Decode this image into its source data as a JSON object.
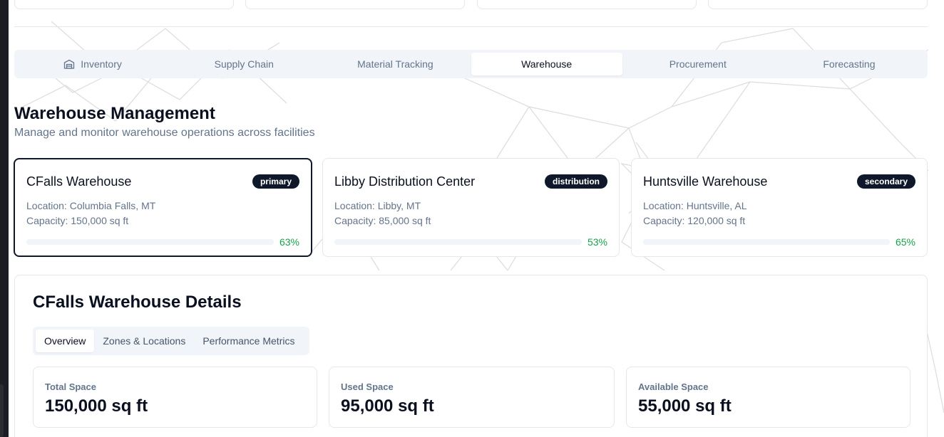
{
  "tabs": [
    {
      "label": "Inventory",
      "icon": "warehouse-icon"
    },
    {
      "label": "Supply Chain"
    },
    {
      "label": "Material Tracking"
    },
    {
      "label": "Warehouse",
      "active": true
    },
    {
      "label": "Procurement"
    },
    {
      "label": "Forecasting"
    }
  ],
  "header": {
    "title": "Warehouse Management",
    "subtitle": "Manage and monitor warehouse operations across facilities"
  },
  "warehouses": [
    {
      "name": "CFalls Warehouse",
      "badge": "primary",
      "location": "Location: Columbia Falls, MT",
      "capacity": "Capacity: 150,000 sq ft",
      "utilization": 63,
      "utilization_label": "63%",
      "selected": true
    },
    {
      "name": "Libby Distribution Center",
      "badge": "distribution",
      "location": "Location: Libby, MT",
      "capacity": "Capacity: 85,000 sq ft",
      "utilization": 53,
      "utilization_label": "53%"
    },
    {
      "name": "Huntsville Warehouse",
      "badge": "secondary",
      "location": "Location: Huntsville, AL",
      "capacity": "Capacity: 120,000 sq ft",
      "utilization": 65,
      "utilization_label": "65%"
    }
  ],
  "details": {
    "title": "CFalls Warehouse Details",
    "tabs": [
      "Overview",
      "Zones & Locations",
      "Performance Metrics"
    ],
    "active_tab": "Overview",
    "stats": [
      {
        "label": "Total Space",
        "value": "150,000 sq ft"
      },
      {
        "label": "Used Space",
        "value": "95,000 sq ft"
      },
      {
        "label": "Available Space",
        "value": "55,000 sq ft"
      }
    ]
  },
  "colors": {
    "accent": "#0f172a",
    "success": "#16a34a",
    "muted": "#64748b",
    "tab_bg": "#f1f5f9"
  }
}
